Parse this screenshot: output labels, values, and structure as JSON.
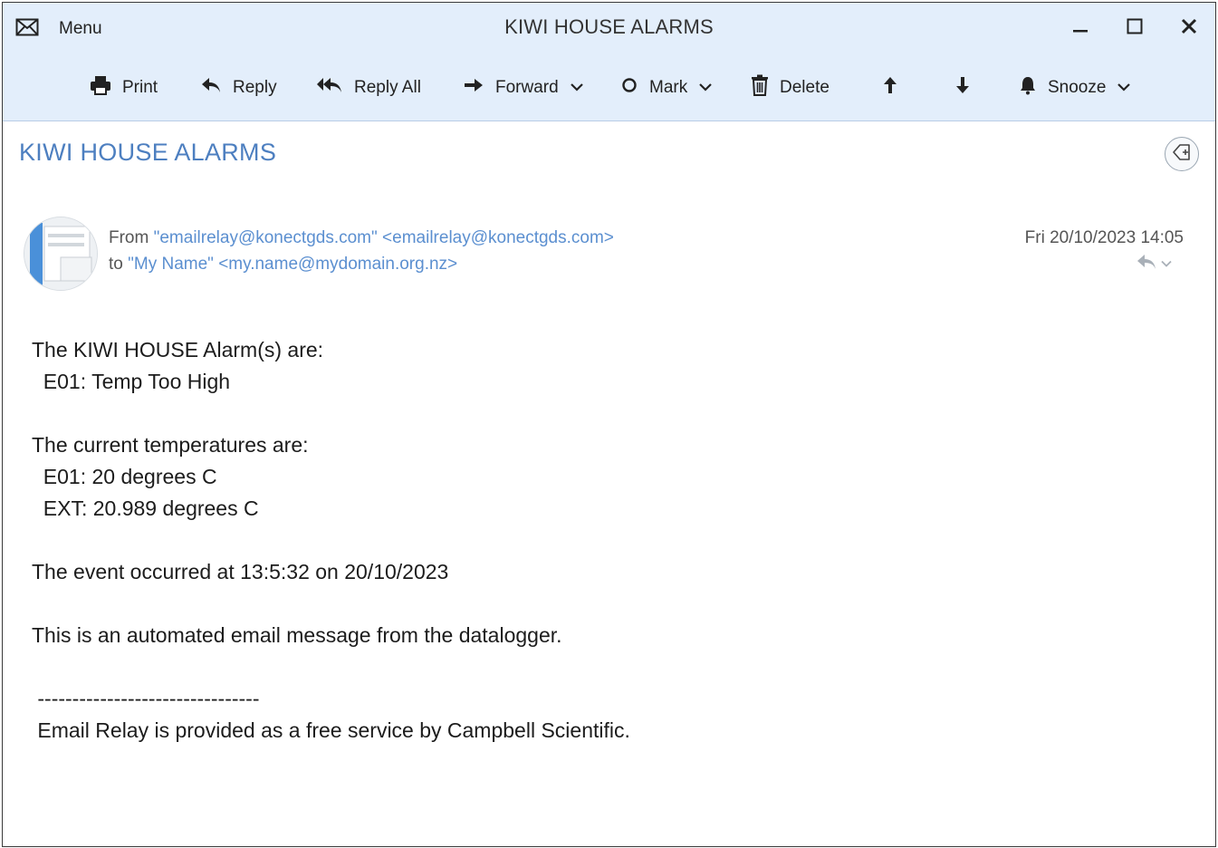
{
  "window": {
    "menu_label": "Menu",
    "title": "KIWI HOUSE ALARMS"
  },
  "toolbar": {
    "print": "Print",
    "reply": "Reply",
    "reply_all": "Reply All",
    "forward": "Forward",
    "mark": "Mark",
    "delete": "Delete",
    "snooze": "Snooze"
  },
  "message": {
    "subject": "KIWI HOUSE ALARMS",
    "from_prefix": "From",
    "from_name": "\"emailrelay@konectgds.com\"",
    "from_address": "<emailrelay@konectgds.com>",
    "to_prefix": "to",
    "to_name": "\"My Name\"",
    "to_address": "<my.name@mydomain.org.nz>",
    "date": "Fri 20/10/2023 14:05"
  },
  "body_lines": [
    "The KIWI HOUSE Alarm(s) are:",
    "  E01: Temp Too High",
    "",
    "The current temperatures are:",
    "  E01: 20 degrees C",
    "  EXT: 20.989 degrees C",
    "",
    "The event occurred at 13:5:32 on 20/10/2023",
    "",
    "This is an automated email message from the datalogger.",
    "",
    " --------------------------------",
    " Email Relay is provided as a free service by Campbell Scientific."
  ],
  "colors": {
    "header_bg": "#e3eefb",
    "subject": "#4d7fc0",
    "link": "#5b8fd0"
  }
}
